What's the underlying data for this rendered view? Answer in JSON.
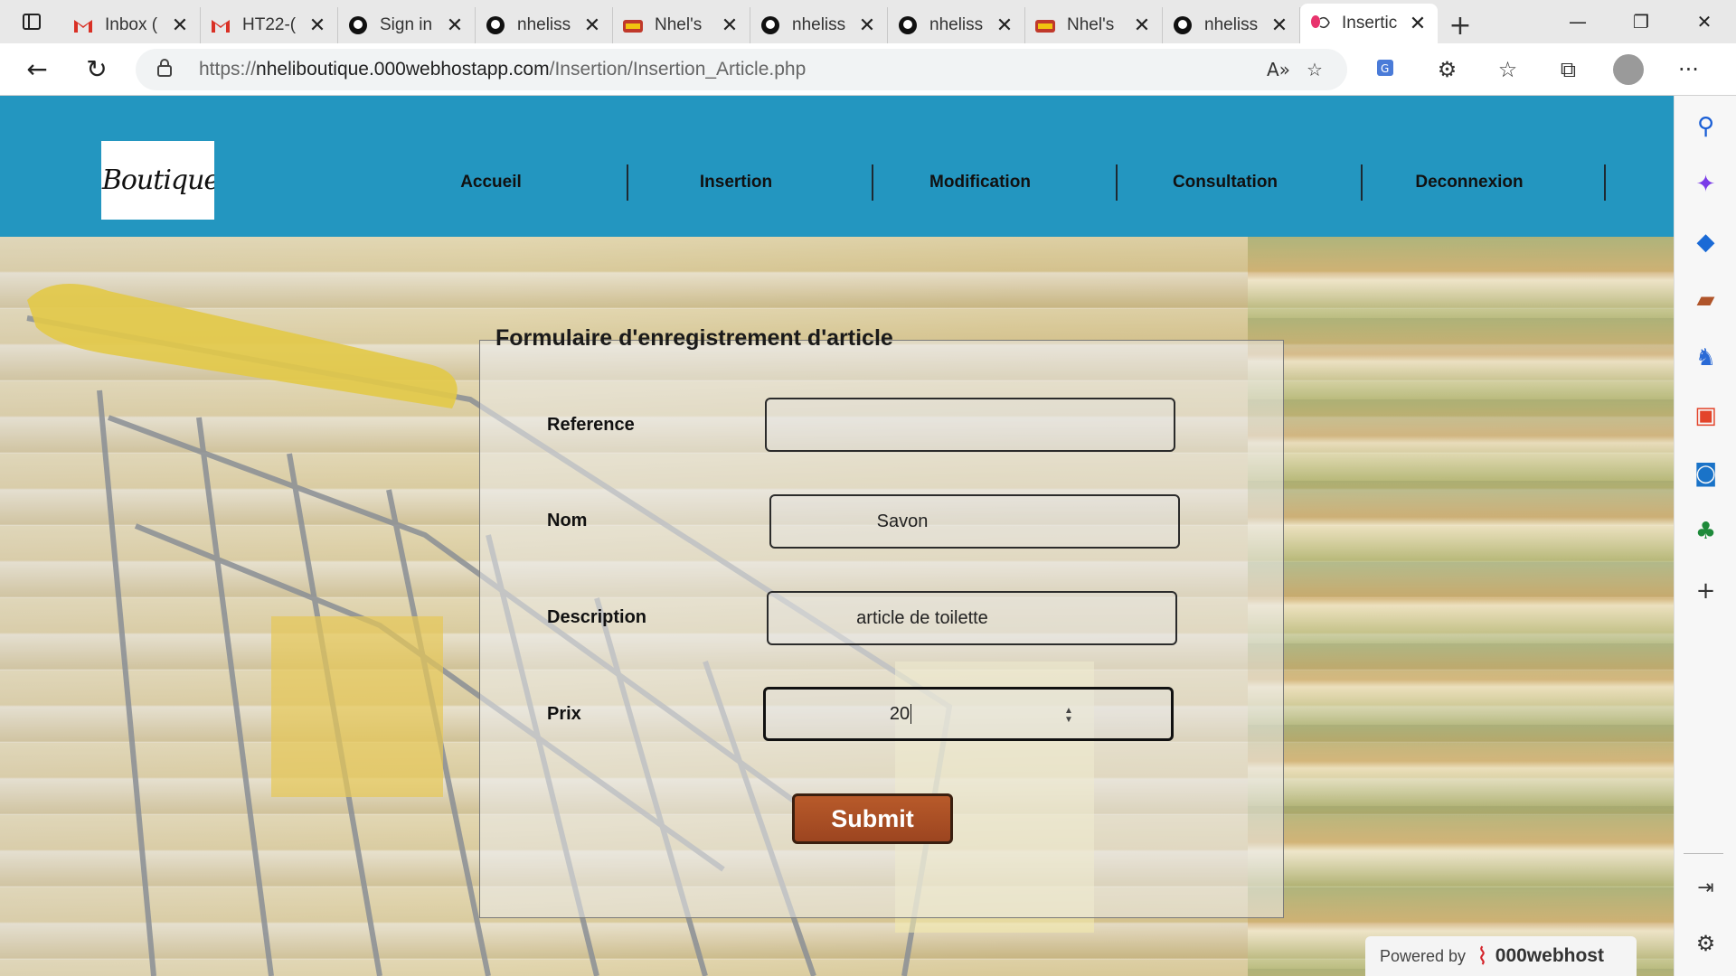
{
  "browser": {
    "tabs": [
      {
        "title": "Inbox (",
        "icon": "gmail-icon"
      },
      {
        "title": "HT22-(",
        "icon": "gmail-icon"
      },
      {
        "title": "Sign in",
        "icon": "github-icon"
      },
      {
        "title": "nheliss",
        "icon": "github-icon"
      },
      {
        "title": "Nhel's",
        "icon": "shop-icon"
      },
      {
        "title": "nheliss",
        "icon": "github-icon"
      },
      {
        "title": "nheliss",
        "icon": "github-icon"
      },
      {
        "title": "Nhel's",
        "icon": "shop-icon"
      },
      {
        "title": "nheliss",
        "icon": "github-icon"
      },
      {
        "title": "Insertic",
        "icon": "boutique-icon",
        "active": true
      }
    ],
    "address": {
      "prefix": "https://",
      "host": "nheliboutique.000webhostapp.com",
      "path": "/Insertion/Insertion_Article.php"
    }
  },
  "site": {
    "logo_text": "Boutique",
    "nav": [
      "Accueil",
      "Insertion",
      "Modification",
      "Consultation",
      "Deconnexion"
    ]
  },
  "form": {
    "title": "Formulaire d'enregistrement d'article",
    "fields": {
      "reference": {
        "label": "Reference",
        "value": ""
      },
      "nom": {
        "label": "Nom",
        "value": "Savon"
      },
      "description": {
        "label": "Description",
        "value": "article de toilette"
      },
      "prix": {
        "label": "Prix",
        "value": "20"
      }
    },
    "submit_label": "Submit"
  },
  "footer": {
    "powered_by": "Powered by",
    "host_brand": "000webhost"
  },
  "colors": {
    "header": "#2396c0",
    "submit": "#a94e24"
  }
}
